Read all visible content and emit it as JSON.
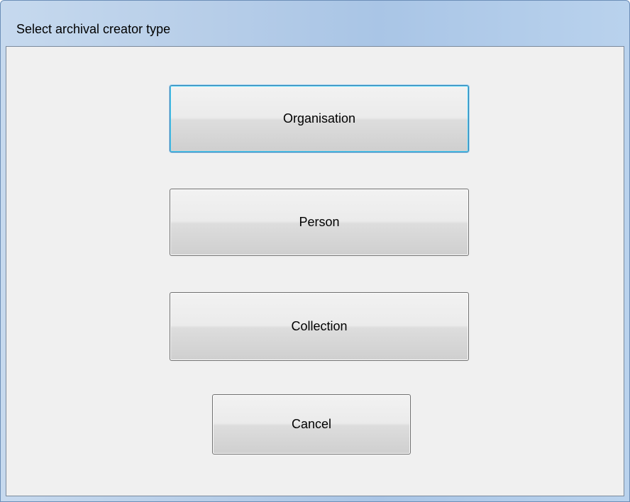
{
  "window": {
    "title": "Select archival creator type"
  },
  "buttons": {
    "organisation": "Organisation",
    "person": "Person",
    "collection": "Collection",
    "cancel": "Cancel"
  },
  "state": {
    "focused_button": "Organisation"
  },
  "colors": {
    "title_bar": "#b6cde8",
    "client_background": "#f0f0f0",
    "focus_border": "#3c7fb1"
  }
}
